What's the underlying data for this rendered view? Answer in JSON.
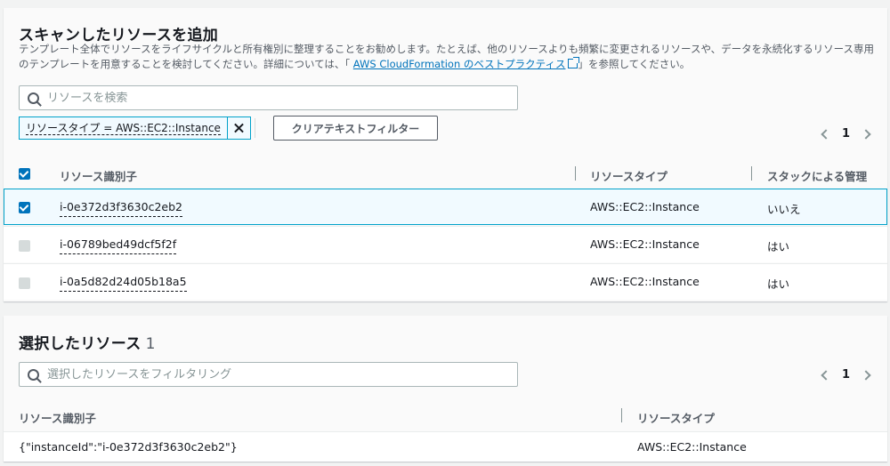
{
  "scan": {
    "title": "スキャンしたリソースを追加",
    "description_pre": "テンプレート全体でリソースをライフサイクルと所有権別に整理することをお勧めします。たとえば、他のリソースよりも頻繁に変更されるリソースや、データを永続化するリソース専用のテンプレートを用意することを検討してください。詳細については、「 ",
    "description_link": "AWS CloudFormation のベストプラクティス",
    "description_post": "」を参照してください。",
    "search_placeholder": "リソースを検索",
    "filter_token": "リソースタイプ = AWS::EC2::Instance",
    "clear_button": "クリアテキストフィルター",
    "page": "1",
    "columns": [
      "リソース識別子",
      "リソースタイプ",
      "スタックによる管理"
    ],
    "rows": [
      {
        "id": "i-0e372d3f3630c2eb2",
        "type": "AWS::EC2::Instance",
        "managed": "いいえ",
        "selected": true
      },
      {
        "id": "i-06789bed49dcf5f2f",
        "type": "AWS::EC2::Instance",
        "managed": "はい",
        "selected": false
      },
      {
        "id": "i-0a5d82d24d05b18a5",
        "type": "AWS::EC2::Instance",
        "managed": "はい",
        "selected": false
      }
    ],
    "colors": {
      "accent": "#0073bb",
      "selected_bg": "#f1faff",
      "selected_border": "#00a1c9"
    }
  },
  "selected": {
    "title": "選択したリソース",
    "count": "1",
    "search_placeholder": "選択したリソースをフィルタリング",
    "page": "1",
    "columns": [
      "リソース識別子",
      "リソースタイプ"
    ],
    "rows": [
      {
        "id": "{\"instanceId\":\"i-0e372d3f3630c2eb2\"}",
        "type": "AWS::EC2::Instance"
      }
    ]
  }
}
